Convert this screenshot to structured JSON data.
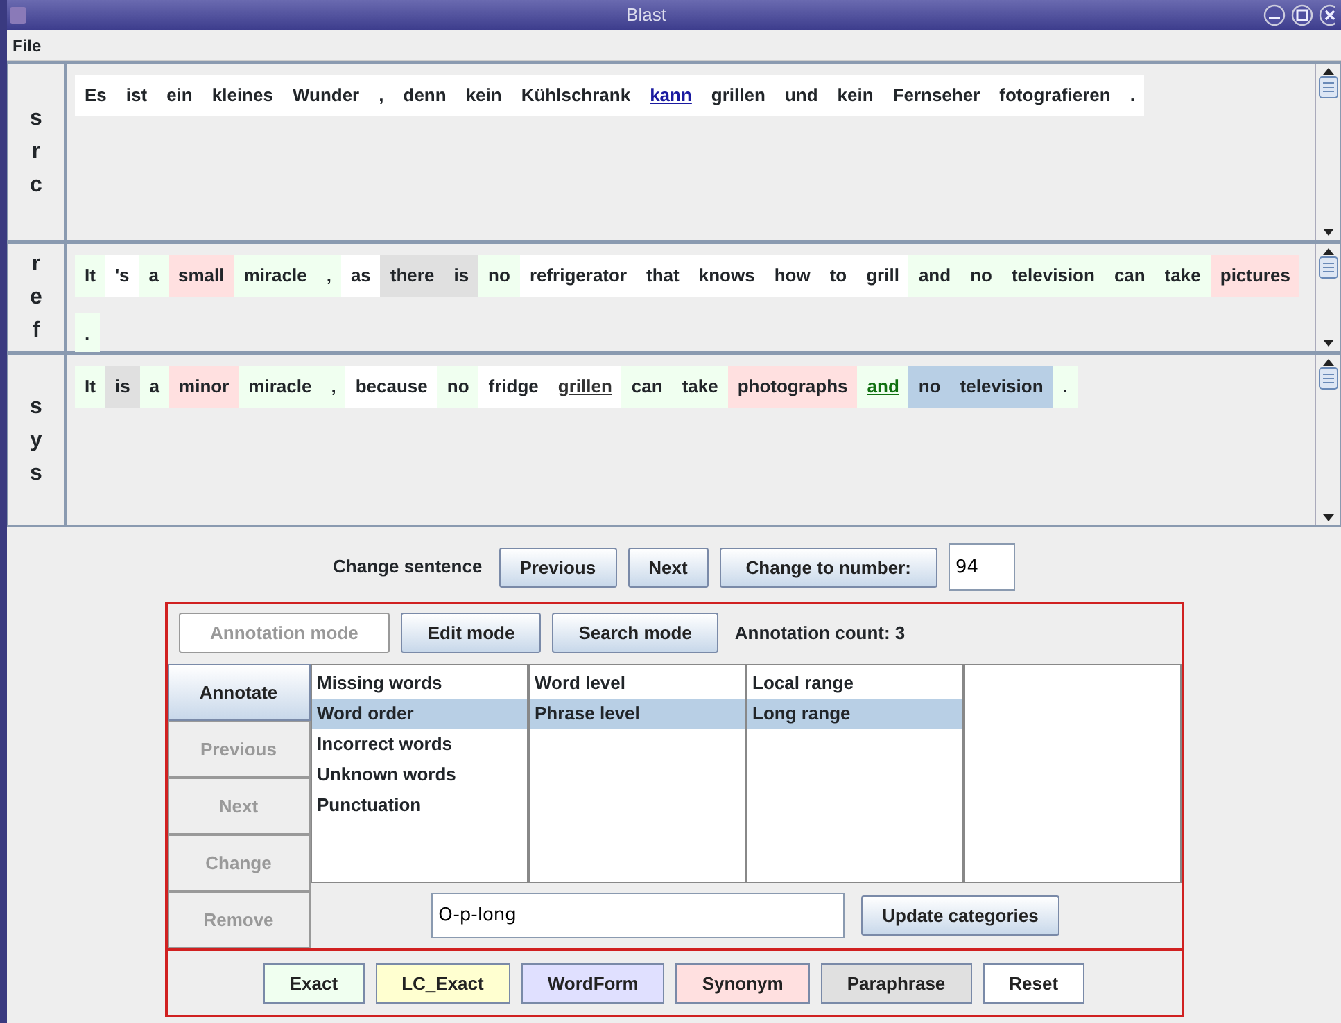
{
  "window": {
    "title": "Blast"
  },
  "menu": [
    "File"
  ],
  "sentences": [
    {
      "label": "src",
      "tokens": [
        {
          "text": "Es",
          "color": "#ffffff",
          "kind": "plain"
        },
        {
          "text": "ist",
          "color": "#ffffff",
          "kind": "plain"
        },
        {
          "text": "ein",
          "color": "#ffffff",
          "kind": "plain"
        },
        {
          "text": "kleines",
          "color": "#ffffff",
          "kind": "plain"
        },
        {
          "text": "Wunder",
          "color": "#ffffff",
          "kind": "plain"
        },
        {
          "text": ",",
          "color": "#ffffff",
          "kind": "plain"
        },
        {
          "text": "denn",
          "color": "#ffffff",
          "kind": "plain"
        },
        {
          "text": "kein",
          "color": "#ffffff",
          "kind": "plain"
        },
        {
          "text": "Kühlschrank",
          "color": "#ffffff",
          "kind": "plain"
        },
        {
          "text": "kann",
          "color": "#ffffff",
          "kind": "link"
        },
        {
          "text": "grillen",
          "color": "#ffffff",
          "kind": "plain"
        },
        {
          "text": "und",
          "color": "#ffffff",
          "kind": "plain"
        },
        {
          "text": "kein",
          "color": "#ffffff",
          "kind": "plain"
        },
        {
          "text": "Fernseher",
          "color": "#ffffff",
          "kind": "plain"
        },
        {
          "text": "fotografieren",
          "color": "#ffffff",
          "kind": "plain"
        },
        {
          "text": ".",
          "color": "#ffffff",
          "kind": "plain"
        }
      ]
    },
    {
      "label": "ref",
      "tokens": [
        {
          "text": "It",
          "color": "#f0fff0",
          "kind": "plain"
        },
        {
          "text": "'s",
          "color": "#ffffff",
          "kind": "plain"
        },
        {
          "text": "a",
          "color": "#f0fff0",
          "kind": "plain"
        },
        {
          "text": "small",
          "color": "#ffe0e0",
          "kind": "plain"
        },
        {
          "text": "miracle",
          "color": "#f0fff0",
          "kind": "plain"
        },
        {
          "text": ",",
          "color": "#f0fff0",
          "kind": "plain"
        },
        {
          "text": "as",
          "color": "#ffffff",
          "kind": "plain"
        },
        {
          "text": "there",
          "color": "#e0e0e0",
          "kind": "plain"
        },
        {
          "text": "is",
          "color": "#e0e0e0",
          "kind": "plain"
        },
        {
          "text": "no",
          "color": "#f0fff0",
          "kind": "plain"
        },
        {
          "text": "refrigerator",
          "color": "#ffffff",
          "kind": "plain"
        },
        {
          "text": "that",
          "color": "#ffffff",
          "kind": "plain"
        },
        {
          "text": "knows",
          "color": "#ffffff",
          "kind": "plain"
        },
        {
          "text": "how",
          "color": "#ffffff",
          "kind": "plain"
        },
        {
          "text": "to",
          "color": "#ffffff",
          "kind": "plain"
        },
        {
          "text": "grill",
          "color": "#ffffff",
          "kind": "plain"
        },
        {
          "text": "and",
          "color": "#f0fff0",
          "kind": "plain"
        },
        {
          "text": "no",
          "color": "#f0fff0",
          "kind": "plain"
        },
        {
          "text": "television",
          "color": "#f0fff0",
          "kind": "plain"
        },
        {
          "text": "can",
          "color": "#f0fff0",
          "kind": "plain"
        },
        {
          "text": "take",
          "color": "#f0fff0",
          "kind": "plain"
        },
        {
          "text": "pictures",
          "color": "#ffe0e0",
          "kind": "plain"
        },
        {
          "text": ".",
          "color": "#f0fff0",
          "kind": "plain"
        }
      ]
    },
    {
      "label": "sys",
      "tokens": [
        {
          "text": "It",
          "color": "#f0fff0",
          "kind": "plain"
        },
        {
          "text": "is",
          "color": "#e0e0e0",
          "kind": "plain"
        },
        {
          "text": "a",
          "color": "#f0fff0",
          "kind": "plain"
        },
        {
          "text": "minor",
          "color": "#ffe0e0",
          "kind": "plain"
        },
        {
          "text": "miracle",
          "color": "#f0fff0",
          "kind": "plain"
        },
        {
          "text": ",",
          "color": "#f0fff0",
          "kind": "plain"
        },
        {
          "text": "because",
          "color": "#ffffff",
          "kind": "plain"
        },
        {
          "text": "no",
          "color": "#f0fff0",
          "kind": "plain"
        },
        {
          "text": "fridge",
          "color": "#ffffff",
          "kind": "plain"
        },
        {
          "text": "grillen",
          "color": "#ffffff",
          "kind": "marked"
        },
        {
          "text": "can",
          "color": "#f0fff0",
          "kind": "plain"
        },
        {
          "text": "take",
          "color": "#f0fff0",
          "kind": "plain"
        },
        {
          "text": "photographs",
          "color": "#ffe0e0",
          "kind": "plain"
        },
        {
          "text": "and",
          "color": "#f0fff0",
          "kind": "aligned"
        },
        {
          "text": "no",
          "color": "#b8cfe5",
          "kind": "plain"
        },
        {
          "text": "television",
          "color": "#b8cfe5",
          "kind": "plain"
        },
        {
          "text": ".",
          "color": "#f0fff0",
          "kind": "plain"
        }
      ]
    }
  ],
  "navigation": {
    "label": "Change sentence",
    "buttons": [
      "Previous",
      "Next",
      "Change to number:"
    ],
    "number": "94"
  },
  "modes": [
    {
      "label": "Annotation mode",
      "disabled": true
    },
    {
      "label": "Edit mode",
      "disabled": false
    },
    {
      "label": "Search mode",
      "disabled": false
    }
  ],
  "annotation_count": "Annotation count: 3",
  "actions": [
    {
      "label": "Annotate",
      "disabled": false,
      "selected": true
    },
    {
      "label": "Previous",
      "disabled": true,
      "selected": false
    },
    {
      "label": "Next",
      "disabled": true,
      "selected": false
    },
    {
      "label": "Change",
      "disabled": true,
      "selected": false
    },
    {
      "label": "Remove",
      "disabled": true,
      "selected": false
    }
  ],
  "category_lists": [
    {
      "items": [
        {
          "label": "Missing words",
          "selected": false
        },
        {
          "label": "Word order",
          "selected": true
        },
        {
          "label": "Incorrect words",
          "selected": false
        },
        {
          "label": "Unknown words",
          "selected": false
        },
        {
          "label": "Punctuation",
          "selected": false
        }
      ]
    },
    {
      "items": [
        {
          "label": "Word level",
          "selected": false
        },
        {
          "label": "Phrase level",
          "selected": true
        }
      ]
    },
    {
      "items": [
        {
          "label": "Local range",
          "selected": false
        },
        {
          "label": "Long range",
          "selected": true
        }
      ]
    }
  ],
  "category_code": "O-p-long",
  "update_button": "Update categories",
  "legend": [
    {
      "label": "Exact",
      "color": "#f0fff0"
    },
    {
      "label": "LC_Exact",
      "color": "#ffffd0"
    },
    {
      "label": "WordForm",
      "color": "#e0e0ff"
    },
    {
      "label": "Synonym",
      "color": "#ffe0e0"
    },
    {
      "label": "Paraphrase",
      "color": "#e0e0e0"
    },
    {
      "label": "Reset",
      "color": "#ffffff"
    }
  ]
}
